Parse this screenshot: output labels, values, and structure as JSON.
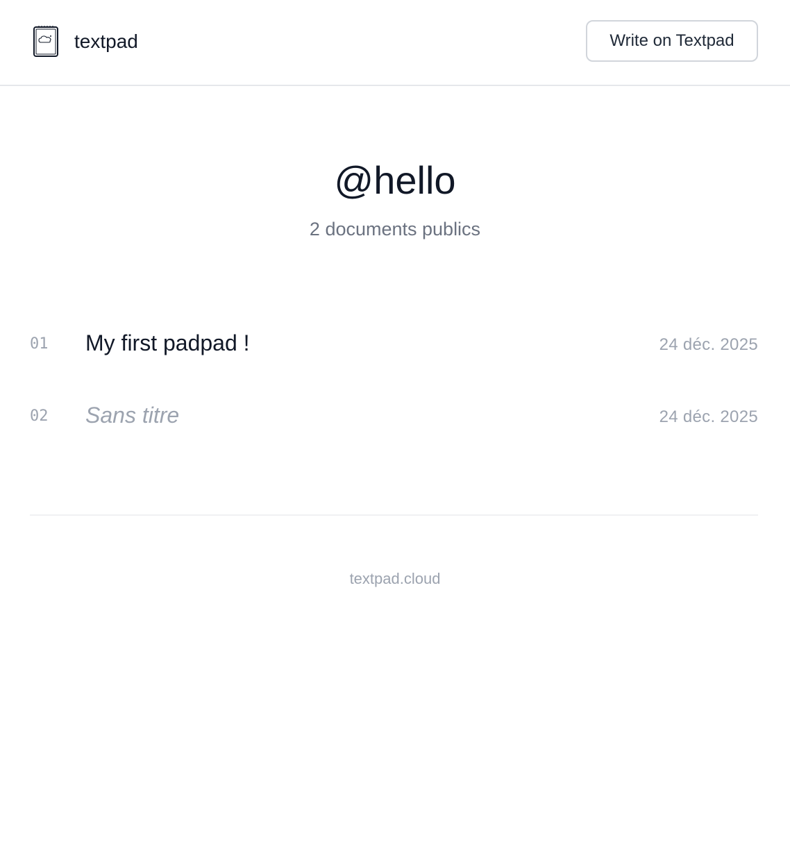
{
  "header": {
    "logo_text": "textpad",
    "logo_icon": "notepad-icon",
    "write_button_label": "Write on Textpad"
  },
  "profile": {
    "username": "@hello",
    "documents_count": "2 documents publics"
  },
  "documents": [
    {
      "number": "01",
      "title": "My first padpad !",
      "date": "24 déc. 2025",
      "untitled": false
    },
    {
      "number": "02",
      "title": "Sans titre",
      "date": "24 déc. 2025",
      "untitled": true
    }
  ],
  "footer": {
    "text": "textpad.cloud"
  },
  "colors": {
    "text_primary": "#111827",
    "text_secondary": "#6b7280",
    "text_muted": "#9ca3af",
    "border": "#e5e7eb"
  }
}
